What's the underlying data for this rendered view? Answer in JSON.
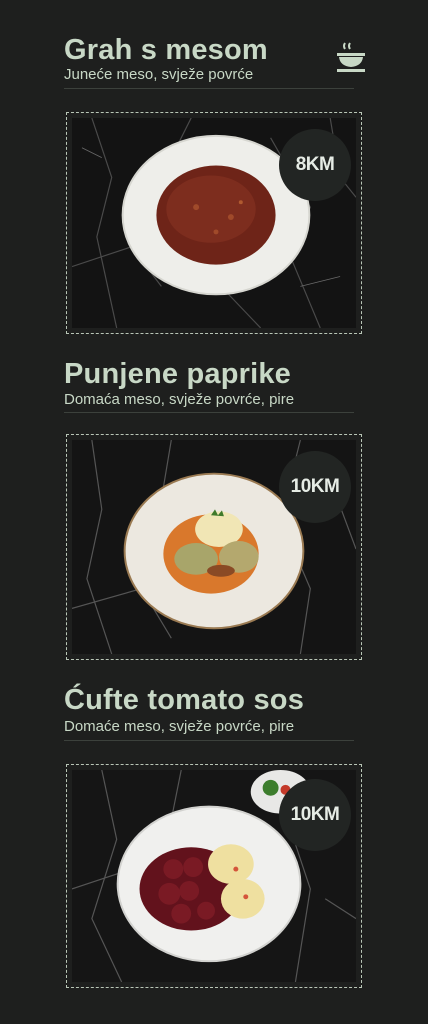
{
  "menu": {
    "items": [
      {
        "title": "Grah s mesom",
        "description": "Juneće meso, svježe povrće",
        "price": "8KM",
        "dish_icon": "soup-bowl-icon",
        "photo": "bowl of bean stew with meat on white plate"
      },
      {
        "title": "Punjene paprike",
        "description": "Domaća meso, svježe povrće, pire",
        "price": "10KM",
        "photo": "stuffed peppers with mashed potatoes"
      },
      {
        "title": "Ćufte tomato sos",
        "description": "Domaće meso, svježe povrće, pire",
        "price": "10KM",
        "photo": "meatballs in tomato sauce with rice"
      }
    ]
  },
  "colors": {
    "background": "#1e1f1e",
    "text": "#c8d8c6",
    "badge": "#222523",
    "frame": "#b9c6b7"
  }
}
